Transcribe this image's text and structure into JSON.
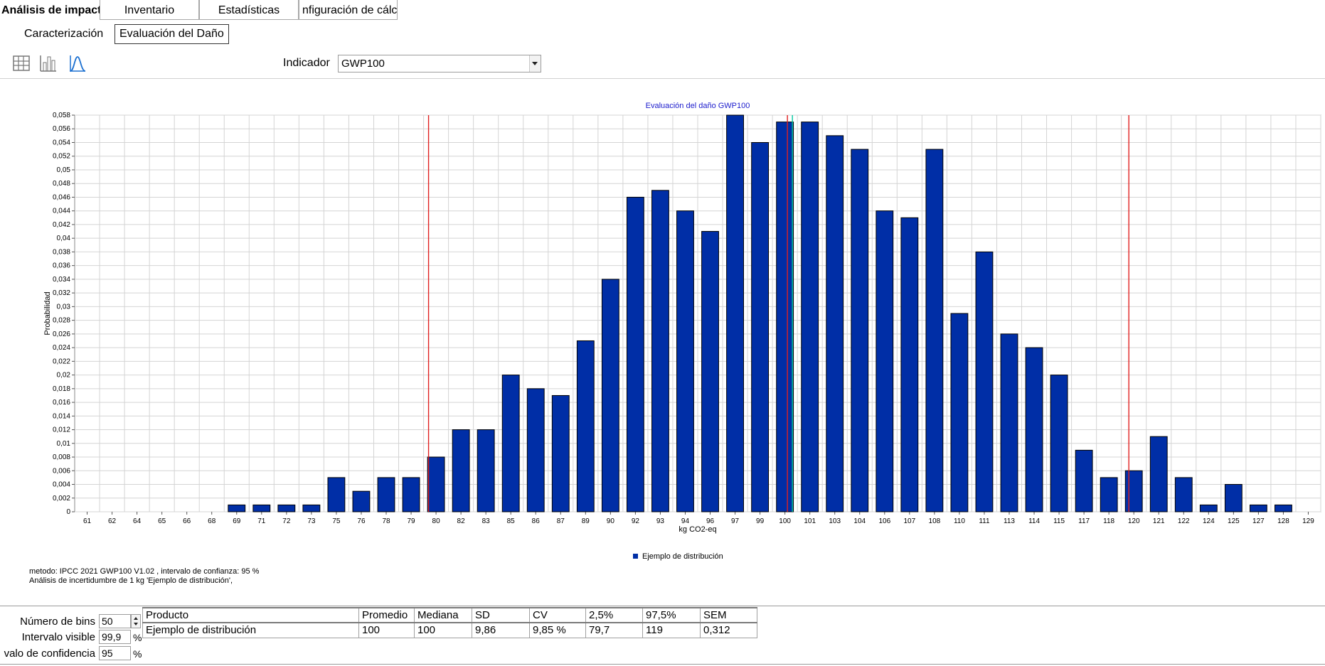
{
  "tabs": [
    {
      "label": "Análisis de impacto",
      "active": true
    },
    {
      "label": "Inventario",
      "active": false
    },
    {
      "label": "Estadísticas",
      "active": false
    },
    {
      "label": "nfiguración de cálcu",
      "active": false
    }
  ],
  "subtabs": [
    {
      "label": "Caracterización",
      "active": false
    },
    {
      "label": "Evaluación del Daño",
      "active": true
    }
  ],
  "toolbar": {
    "icons": [
      "table-icon",
      "bar-chart-icon",
      "distribution-curve-icon"
    ]
  },
  "indicator": {
    "label": "Indicador",
    "value": "GWP100"
  },
  "chart_data": {
    "type": "bar",
    "title": "Evaluación del daño GWP100",
    "xlabel": "kg CO2-eq",
    "ylabel": "Probabilidad",
    "ylim": [
      0,
      0.058
    ],
    "y_ticks": [
      "0",
      "0,002",
      "0,004",
      "0,006",
      "0,008",
      "0,01",
      "0,012",
      "0,014",
      "0,016",
      "0,018",
      "0,02",
      "0,022",
      "0,024",
      "0,026",
      "0,028",
      "0,03",
      "0,032",
      "0,034",
      "0,036",
      "0,038",
      "0,04",
      "0,042",
      "0,044",
      "0,046",
      "0,048",
      "0,05",
      "0,052",
      "0,054",
      "0,056",
      "0,058"
    ],
    "categories": [
      "61",
      "62",
      "64",
      "65",
      "66",
      "68",
      "69",
      "71",
      "72",
      "73",
      "75",
      "76",
      "78",
      "79",
      "80",
      "82",
      "83",
      "85",
      "86",
      "87",
      "89",
      "90",
      "92",
      "93",
      "94",
      "96",
      "97",
      "99",
      "100",
      "101",
      "103",
      "104",
      "106",
      "107",
      "108",
      "110",
      "111",
      "113",
      "114",
      "115",
      "117",
      "118",
      "120",
      "121",
      "122",
      "124",
      "125",
      "127",
      "128",
      "129"
    ],
    "series": [
      {
        "name": "Ejemplo de distribución",
        "color": "#002EA6",
        "values": [
          0,
          0,
          0,
          0,
          0,
          0,
          0.001,
          0.001,
          0.001,
          0.001,
          0.005,
          0.003,
          0.005,
          0.005,
          0.008,
          0.012,
          0.012,
          0.02,
          0.018,
          0.017,
          0.025,
          0.034,
          0.046,
          0.047,
          0.044,
          0.041,
          0.058,
          0.054,
          0.057,
          0.057,
          0.055,
          0.053,
          0.044,
          0.043,
          0.053,
          0.029,
          0.038,
          0.026,
          0.024,
          0.02,
          0.009,
          0.005,
          0.006,
          0.011,
          0.005,
          0.001,
          0.004,
          0.001,
          0.001,
          0
        ]
      }
    ],
    "reference_lines": [
      {
        "value": 79.7,
        "color": "#E02020"
      },
      {
        "value": 100.1,
        "color": "#E02020"
      },
      {
        "value": 100.3,
        "color": "#00C8A0"
      },
      {
        "value": 119.6,
        "color": "#E02020"
      }
    ],
    "grid": true,
    "legend_position": "bottom-center"
  },
  "meta": {
    "line1": "metodo: IPCC 2021 GWP100 V1.02 , intervalo de confianza: 95 %",
    "line2": "Análisis de incertidumbre de  1 kg 'Ejemplo de distribución',"
  },
  "params": {
    "bins_label": "Número de bins",
    "bins_value": "50",
    "visible_label": "Intervalo visible",
    "visible_value": "99,9",
    "visible_unit": "%",
    "confidence_label": "valo de confidencia",
    "confidence_value": "95",
    "confidence_unit": "%"
  },
  "stats_table": {
    "headers": [
      "Producto",
      "Promedio",
      "Mediana",
      "SD",
      "CV",
      "2,5%",
      "97,5%",
      "SEM"
    ],
    "rows": [
      [
        "Ejemplo de distribución",
        "100",
        "100",
        "9,86",
        "9,85 %",
        "79,7",
        "119",
        "0,312"
      ]
    ]
  }
}
